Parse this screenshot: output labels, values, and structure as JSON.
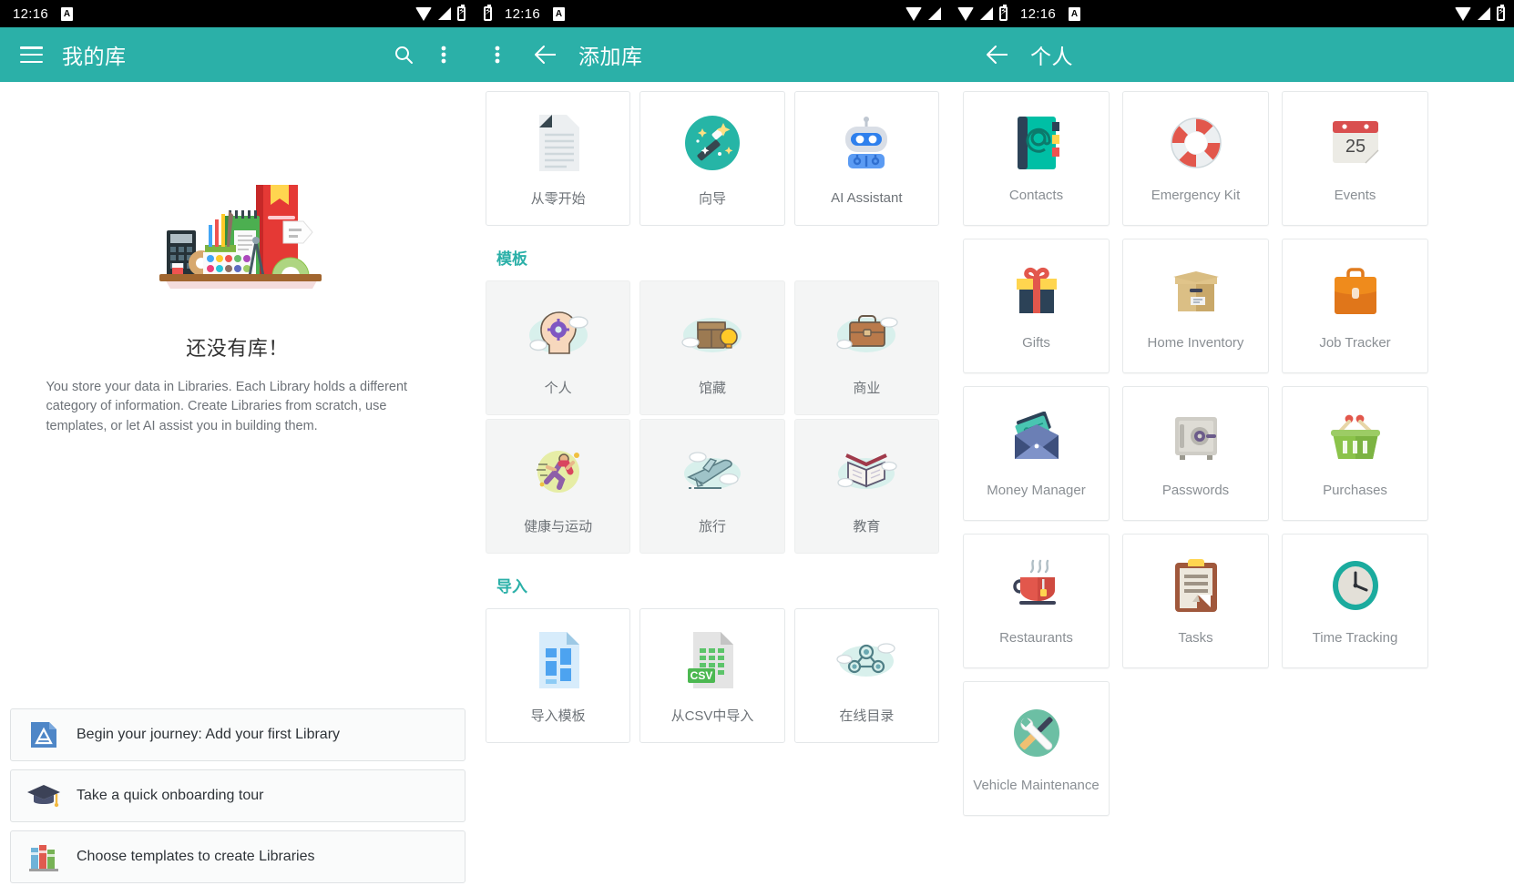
{
  "status_bar": {
    "time": "12:16",
    "app_badge": "A"
  },
  "screen1": {
    "title": "我的库",
    "menu_icon": "hamburger-icon",
    "search_icon": "search-icon",
    "overflow_icon": "more-vertical-icon",
    "empty": {
      "title": "还没有库！",
      "description": "You store your data in Libraries. Each Library holds a different category of information. Create Libraries from scratch, use templates, or let AI assist you in building them."
    },
    "actions": [
      {
        "label": "Begin your journey: Add your first Library",
        "icon": "add-library-icon"
      },
      {
        "label": "Take a quick onboarding tour",
        "icon": "graduation-cap-icon"
      },
      {
        "label": "Choose templates to create Libraries",
        "icon": "books-icon"
      }
    ]
  },
  "screen2": {
    "title": "添加库",
    "back_icon": "arrow-back-icon",
    "create_tiles": [
      {
        "label": "从零开始",
        "icon": "blank-document-icon"
      },
      {
        "label": "向导",
        "icon": "magic-wand-icon"
      },
      {
        "label": "AI Assistant",
        "icon": "robot-icon"
      }
    ],
    "templates_heading": "模板",
    "template_tiles": [
      {
        "label": "个人",
        "icon": "head-gear-icon"
      },
      {
        "label": "馆藏",
        "icon": "box-bulb-icon"
      },
      {
        "label": "商业",
        "icon": "briefcase-icon"
      },
      {
        "label": "健康与运动",
        "icon": "runner-icon"
      },
      {
        "label": "旅行",
        "icon": "airplane-icon"
      },
      {
        "label": "教育",
        "icon": "open-book-icon"
      }
    ],
    "import_heading": "导入",
    "import_tiles": [
      {
        "label": "导入模板",
        "icon": "template-file-icon"
      },
      {
        "label": "从CSV中导入",
        "icon": "csv-file-icon"
      },
      {
        "label": "在线目录",
        "icon": "online-catalog-icon"
      }
    ]
  },
  "screen3": {
    "title": "个人",
    "back_icon": "arrow-back-icon",
    "items": [
      {
        "label": "Contacts",
        "icon": "contacts-book-icon"
      },
      {
        "label": "Emergency Kit",
        "icon": "life-ring-icon"
      },
      {
        "label": "Events",
        "icon": "calendar-icon",
        "day": "25"
      },
      {
        "label": "Gifts",
        "icon": "gift-box-icon"
      },
      {
        "label": "Home Inventory",
        "icon": "cardboard-box-icon"
      },
      {
        "label": "Job Tracker",
        "icon": "briefcase-icon"
      },
      {
        "label": "Money Manager",
        "icon": "money-envelope-icon"
      },
      {
        "label": "Passwords",
        "icon": "safe-icon"
      },
      {
        "label": "Purchases",
        "icon": "shopping-basket-icon"
      },
      {
        "label": "Restaurants",
        "icon": "coffee-cup-icon"
      },
      {
        "label": "Tasks",
        "icon": "clipboard-icon"
      },
      {
        "label": "Time Tracking",
        "icon": "clock-icon"
      },
      {
        "label": "Vehicle Maintenance",
        "icon": "tools-icon"
      }
    ]
  },
  "colors": {
    "accent": "#2bb0a8",
    "status_bar": "#000000",
    "text_primary": "#2e3338",
    "text_muted": "#8a8f94"
  }
}
